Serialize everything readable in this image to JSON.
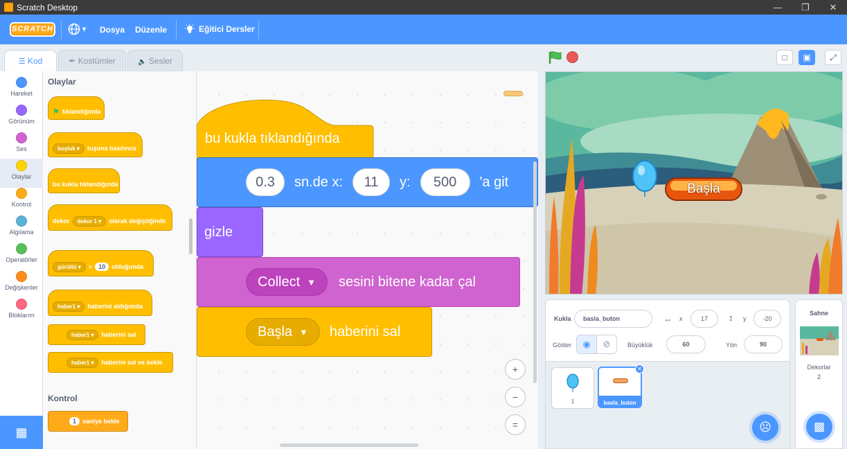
{
  "window": {
    "title": "Scratch Desktop"
  },
  "menu": {
    "logo": "SCRATCH",
    "globe_caret": "▾",
    "file": "Dosya",
    "edit": "Düzenle",
    "tutorials": "Eğitici Dersler"
  },
  "tabs": {
    "code": "Kod",
    "costumes": "Kostümler",
    "sounds": "Sesler"
  },
  "categories": [
    {
      "label": "Hareket",
      "color": "#4c97ff"
    },
    {
      "label": "Görünüm",
      "color": "#9966ff"
    },
    {
      "label": "Ses",
      "color": "#cf63cf"
    },
    {
      "label": "Olaylar",
      "color": "#ffd500"
    },
    {
      "label": "Kontrol",
      "color": "#ffab19"
    },
    {
      "label": "Algılama",
      "color": "#5cb1d6"
    },
    {
      "label": "Operatörler",
      "color": "#59c059"
    },
    {
      "label": "Değişkenler",
      "color": "#ff8c1a"
    },
    {
      "label": "Bloklarım",
      "color": "#ff6680"
    }
  ],
  "palette": {
    "events_heading": "Olaylar",
    "when_flag": "tıklandığında",
    "key_drop": "boşluk ▾",
    "key_text": "tuşuna basılınca",
    "sprite_clicked": "bu kukla tıklandığında",
    "backdrop_label": "dekor",
    "backdrop_drop": "dekor 1 ▾",
    "backdrop_text": "olarak değiştiğinde",
    "loudness_drop": "gürültü ▾",
    "gt": ">",
    "loudness_value": "10",
    "loudness_text": "olduğunda",
    "receive_drop": "haber1 ▾",
    "receive_text": "haberini aldığımda",
    "broadcast_drop": "haber1 ▾",
    "broadcast_text": "haberini sal",
    "broadcast_wait_drop": "haber1 ▾",
    "broadcast_wait_text": "haberini sal ve bekle",
    "control_heading": "Kontrol",
    "wait_value": "1",
    "wait_text": "saniye bekle"
  },
  "script": {
    "hat": "bu kukla tıklandığında",
    "glide_secs": "0.3",
    "glide_text": "sn.de x:",
    "glide_x": "11",
    "glide_y_label": "y:",
    "glide_y": "500",
    "glide_suffix": "'a git",
    "hide": "gizle",
    "sound_drop": "Collect",
    "sound_text": "sesini bitene kadar çal",
    "broadcast_drop": "Başla",
    "broadcast_text": "haberini sal"
  },
  "zoom": {
    "in": "+",
    "out": "−",
    "reset": "="
  },
  "stage": {
    "button_text": "Başla"
  },
  "sprite_info": {
    "sprite_label": "Kukla",
    "sprite_name": "basla_buton",
    "x_label": "x",
    "x_value": "17",
    "y_label": "y",
    "y_value": "-20",
    "show_label": "Göster",
    "size_label": "Büyüklük",
    "size_value": "60",
    "direction_label": "Yön",
    "direction_value": "90"
  },
  "sprites": [
    {
      "name": "1"
    },
    {
      "name": "basla_buton"
    }
  ],
  "stage_panel": {
    "title": "Sahne",
    "backdrops_label": "Dekorlar",
    "backdrops_count": "2"
  },
  "colors": {
    "menu_blue": "#4c97ff",
    "events": "#ffbf00",
    "motion": "#4c97ff",
    "looks": "#9966ff",
    "sound": "#cf63cf"
  }
}
